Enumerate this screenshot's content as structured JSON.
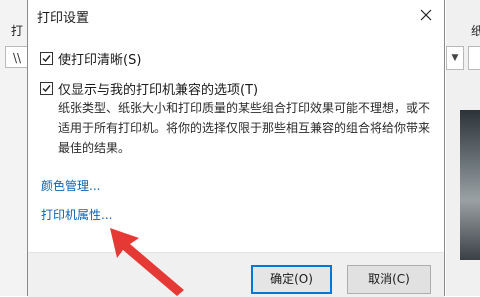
{
  "background_window": {
    "left_label": "打",
    "left_field_value": "\\\\",
    "right_label": "纸"
  },
  "dialog": {
    "title": "打印设置",
    "options": [
      {
        "label": "使打印清晰(S)",
        "checked": true
      },
      {
        "label": "仅显示与我的打印机兼容的选项(T)",
        "checked": true
      }
    ],
    "description_lines": [
      "纸张类型、纸张大小和打印质量的某些组合打印效果可能不理想，或不",
      "适用于所有打印机。将你的选择仅限于那些相互兼容的组合将给你带来",
      "最佳的结果。"
    ],
    "links": {
      "color_management": "颜色管理...",
      "printer_properties": "打印机属性..."
    },
    "buttons": {
      "ok": "确定(O)",
      "cancel": "取消(C)"
    }
  },
  "annotation": {
    "arrow_color": "#e53935"
  },
  "colors": {
    "link": "#0b63b5",
    "focus_border": "#0078d7"
  }
}
